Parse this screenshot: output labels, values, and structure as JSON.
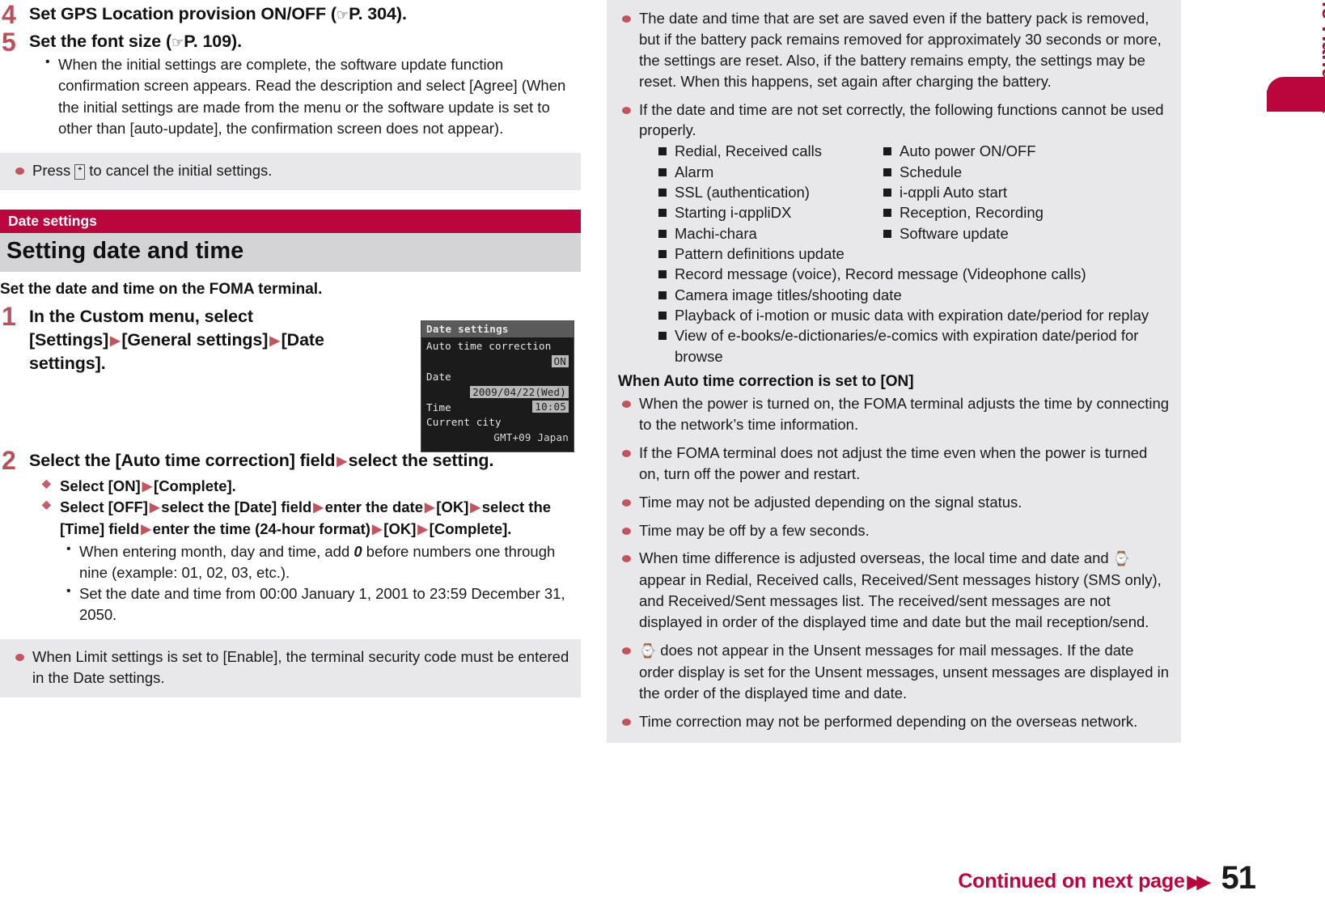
{
  "page": {
    "number": "51",
    "continued_label": "Continued on next page",
    "continued_arrows": "▶▶",
    "side_tab_label": "Before Using the Handset",
    "accent_crimson": "#b9063c",
    "accent_red_bullet": "#c0555f",
    "step_number_color": "#b7515c",
    "note_bg": "#e8e8ea",
    "section_title_bg": "#d4d4d6"
  },
  "left": {
    "steps_top": [
      {
        "num": "4",
        "title_parts": [
          "Set GPS Location provision ON/OFF (",
          "☞",
          "P. 304)."
        ]
      },
      {
        "num": "5",
        "title_parts": [
          "Set the font size (",
          "☞",
          "P. 109)."
        ],
        "bullets": [
          "When the initial settings are complete, the software update function confirmation screen appears. Read the description and select [Agree] (When the initial settings are made from the menu or the software update is set to other than [auto-update], the confirmation screen does not appear)."
        ]
      }
    ],
    "note_top": {
      "bullets_pre": "Press ",
      "bullets_glyph": "ᐩ",
      "bullets_post": " to cancel the initial settings."
    },
    "section": {
      "tag": "Date settings",
      "title": "Setting date and time"
    },
    "lead": "Set the date and time on the FOMA terminal.",
    "step1": {
      "num": "1",
      "seg1": "In the Custom menu, select [Settings]",
      "seg2": "[General settings]",
      "seg3": "[Date settings]."
    },
    "step2": {
      "num": "2",
      "seg1": "Select the [Auto time correction] field",
      "seg2": "select the setting.",
      "diamond1": {
        "a": "Select [ON]",
        "b": "[Complete]."
      },
      "diamond2": {
        "a": "Select [OFF]",
        "b": "select the [Date] field",
        "c": "enter the date",
        "d": "[OK]",
        "e": "select the [Time] field",
        "f": "enter the time (24-hour format)",
        "g": "[OK]",
        "h": "[Complete].",
        "subbullets": [
          {
            "pre": "When entering month, day and time, add ",
            "em": "0",
            "post": " before numbers one through nine (example: 01, 02, 03, etc.)."
          },
          {
            "pre": "Set the date and time from 00:00 January 1, 2001 to 23:59 December 31, 2050.",
            "em": "",
            "post": ""
          }
        ]
      }
    },
    "note_bottom": {
      "text": "When Limit settings is set to [Enable], the terminal security code must be entered in the Date settings."
    },
    "phone_screen": {
      "title": "Date settings",
      "row1_label": "Auto time correction",
      "row1_value": "ON",
      "row2_label": "Date",
      "row2_value": "2009/04/22(Wed)",
      "row3_label": "Time",
      "row3_value": "10:05",
      "row4_label": "Current city",
      "row4_value": "GMT+09 Japan"
    }
  },
  "right": {
    "note": {
      "bullet1": "The date and time that are set are saved even if the battery pack is removed, but if the battery pack remains removed for approximately 30 seconds or more, the settings are reset. Also, if the battery remains empty, the settings may be reset. When this happens, set again after charging the battery.",
      "bullet2": "If the date and time are not set correctly, the following functions cannot be used properly.",
      "functions_col_a": [
        "Redial, Received calls",
        "Alarm",
        "SSL (authentication)",
        "Starting i-αppliDX",
        "Machi-chara"
      ],
      "functions_col_b": [
        "Auto power ON/OFF",
        "Schedule",
        "i-αppli Auto start",
        "Reception, Recording",
        "Software update"
      ],
      "functions_full": [
        "Pattern definitions update",
        "Record message (voice), Record message (Videophone calls)",
        "Camera image titles/shooting date",
        "Playback of i-motion or music data with expiration date/period for replay",
        "View of e-books/e-dictionaries/e-comics with expiration date/period for browse"
      ],
      "subhead": "When Auto time correction is set to [ON]",
      "bullets_on": [
        {
          "pre": "When the power is turned on, the FOMA terminal adjusts the time by connecting to the network’s time information.",
          "glyph": "",
          "post": ""
        },
        {
          "pre": "If the FOMA terminal does not adjust the time even when the power is turned on, turn off the power and restart.",
          "glyph": "",
          "post": ""
        },
        {
          "pre": "Time may not be adjusted depending on the signal status.",
          "glyph": "",
          "post": ""
        },
        {
          "pre": "Time may be off by a few seconds.",
          "glyph": "",
          "post": ""
        },
        {
          "pre": "When time difference is adjusted overseas, the local time and date and ",
          "glyph": "⌚",
          "post": " appear in Redial, Received calls, Received/Sent messages history (SMS only), and Received/Sent messages list. The received/sent messages are not displayed in order of the displayed time and date but the mail reception/send."
        },
        {
          "pre": "",
          "glyph": "⌚",
          "post": " does not appear in the Unsent messages for mail messages. If the date order display is set for the Unsent messages, unsent messages are displayed in the order of the displayed time and date."
        },
        {
          "pre": "Time correction may not be performed depending on the overseas network.",
          "glyph": "",
          "post": ""
        }
      ]
    }
  }
}
